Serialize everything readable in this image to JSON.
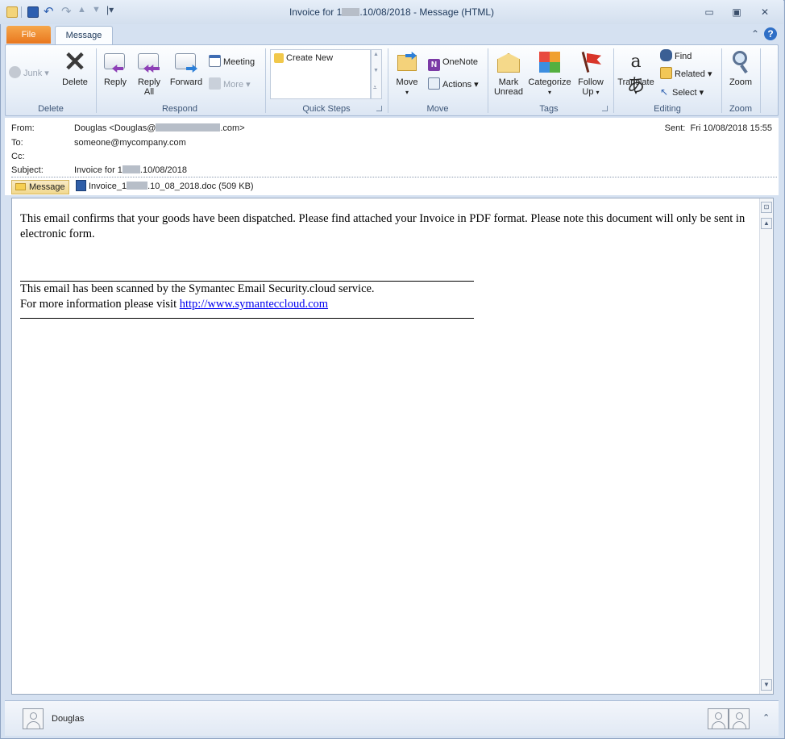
{
  "window": {
    "title_prefix": "Invoice for 1",
    "title_suffix": ".10/08/2018  -  Message (HTML)"
  },
  "tabs": {
    "file": "File",
    "message": "Message"
  },
  "ribbon": {
    "delete_group": {
      "junk": "Junk",
      "delete": "Delete",
      "label": "Delete"
    },
    "respond_group": {
      "reply": "Reply",
      "reply_all_1": "Reply",
      "reply_all_2": "All",
      "forward": "Forward",
      "meeting": "Meeting",
      "more": "More",
      "label": "Respond"
    },
    "quicksteps_group": {
      "create_new": "Create New",
      "label": "Quick Steps"
    },
    "move_group": {
      "move": "Move",
      "onenote": "OneNote",
      "actions": "Actions",
      "label": "Move"
    },
    "tags_group": {
      "mark_unread_1": "Mark",
      "mark_unread_2": "Unread",
      "categorize": "Categorize",
      "follow_up_1": "Follow",
      "follow_up_2": "Up",
      "label": "Tags"
    },
    "editing_group": {
      "translate": "Translate",
      "find": "Find",
      "related": "Related",
      "select": "Select",
      "label": "Editing"
    },
    "zoom_group": {
      "zoom": "Zoom",
      "label": "Zoom"
    }
  },
  "header": {
    "from_label": "From:",
    "from_value_prefix": "Douglas <Douglas@",
    "from_value_suffix": ".com>",
    "to_label": "To:",
    "to_value": "someone@mycompany.com",
    "cc_label": "Cc:",
    "subject_label": "Subject:",
    "subject_prefix": "Invoice for 1",
    "subject_suffix": ".10/08/2018",
    "sent_label": "Sent:",
    "sent_value": "Fri 10/08/2018 15:55"
  },
  "attachments": {
    "message_tab": "Message",
    "file_prefix": "Invoice_1",
    "file_suffix": ".10_08_2018.doc (509 KB)"
  },
  "body": {
    "paragraph": "This email confirms that your goods have been dispatched. Please find attached your Invoice in PDF format. Please note this document will only be sent in electronic form.",
    "scan_line": "This email has been scanned by the Symantec Email Security.cloud service.",
    "info_prefix": "For more information please visit ",
    "link": "http://www.symanteccloud.com"
  },
  "people_pane": {
    "name": "Douglas"
  },
  "colors": {
    "file_tab": "#e9771e",
    "link": "#0000ee",
    "ribbon_label": "#3e5779"
  }
}
